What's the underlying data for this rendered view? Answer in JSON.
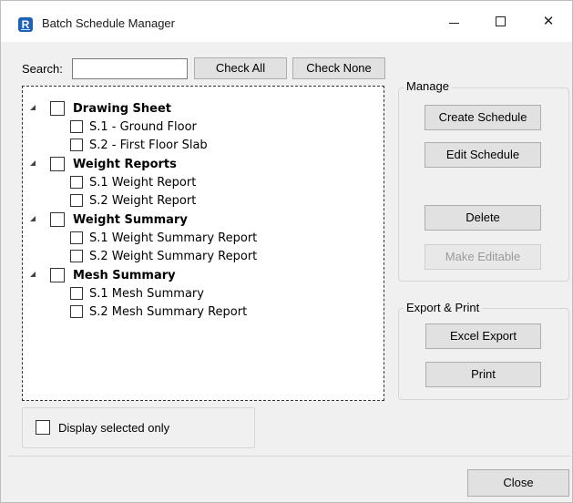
{
  "window": {
    "title": "Batch Schedule Manager",
    "app_icon_letter": "R"
  },
  "search": {
    "label": "Search:",
    "value": "",
    "placeholder": ""
  },
  "buttons": {
    "check_all": "Check All",
    "check_none": "Check None",
    "close": "Close"
  },
  "tree": {
    "groups": [
      {
        "label": "Drawing Sheet",
        "checked": false,
        "expanded": true,
        "children": [
          {
            "label": "S.1 - Ground Floor",
            "checked": false
          },
          {
            "label": "S.2 - First Floor Slab",
            "checked": false
          }
        ]
      },
      {
        "label": "Weight Reports",
        "checked": false,
        "expanded": true,
        "children": [
          {
            "label": "S.1 Weight Report",
            "checked": false
          },
          {
            "label": "S.2 Weight Report",
            "checked": false
          }
        ]
      },
      {
        "label": "Weight Summary",
        "checked": false,
        "expanded": true,
        "children": [
          {
            "label": "S.1 Weight Summary Report",
            "checked": false
          },
          {
            "label": "S.2 Weight Summary Report",
            "checked": false
          }
        ]
      },
      {
        "label": "Mesh Summary",
        "checked": false,
        "expanded": true,
        "children": [
          {
            "label": "S.1 Mesh Summary",
            "checked": false
          },
          {
            "label": "S.2 Mesh Summary Report",
            "checked": false
          }
        ]
      }
    ]
  },
  "manage": {
    "title": "Manage",
    "create": "Create Schedule",
    "edit": "Edit Schedule",
    "delete": "Delete",
    "make_editable": "Make Editable"
  },
  "export": {
    "title": "Export & Print",
    "excel": "Excel Export",
    "print": "Print"
  },
  "options": {
    "display_selected_only": "Display selected only",
    "display_selected_checked": false
  },
  "colors": {
    "accent": "#1e62b8",
    "button_bg": "#e1e1e1",
    "button_border": "#adadad",
    "disabled_text": "#9a9a9a"
  }
}
